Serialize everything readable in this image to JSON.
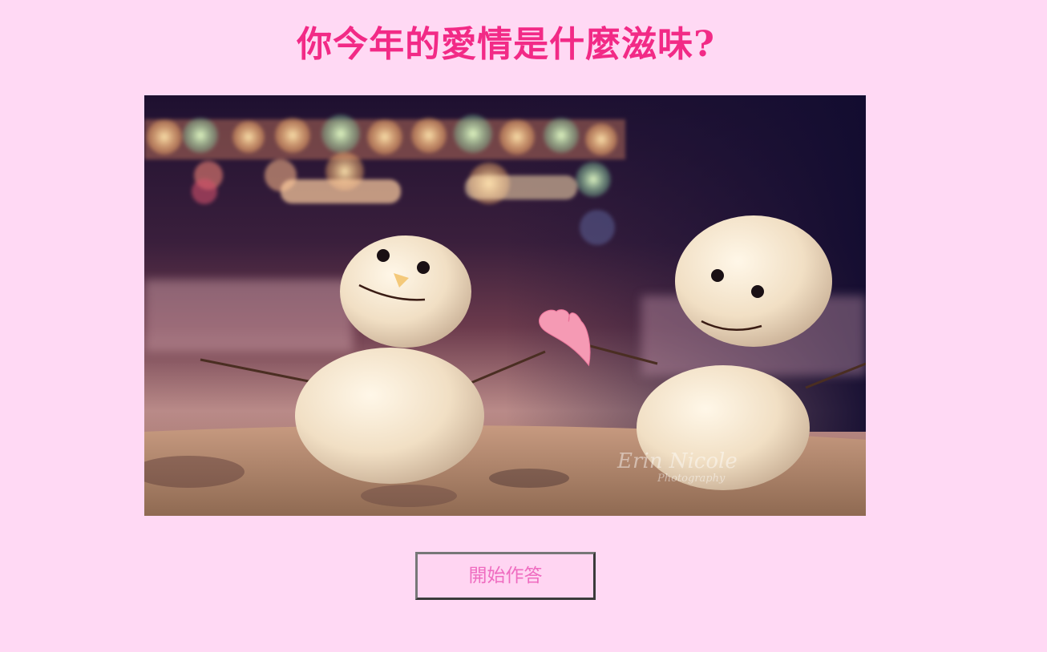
{
  "page": {
    "title": "你今年的愛情是什麼滋味?",
    "colors": {
      "background": "#ffd9f4",
      "title": "#f22a86",
      "button_text": "#ef6cc0",
      "button_background": "#ffd5f2"
    }
  },
  "hero_image": {
    "subject": "two snowmen with a pink paper heart",
    "watermark_text": "Erin Nicole Photography"
  },
  "quiz": {
    "start_label": "開始作答"
  }
}
